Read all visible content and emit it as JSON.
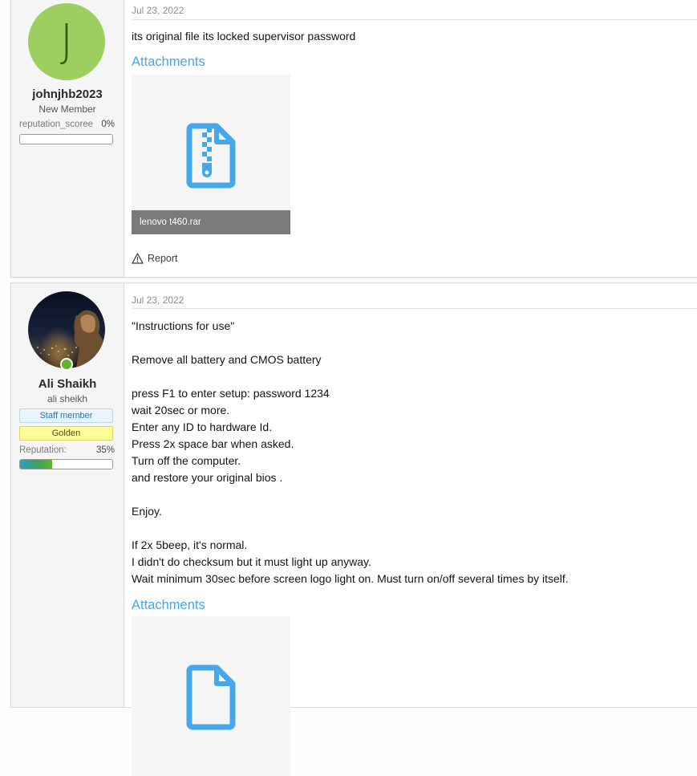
{
  "posts": [
    {
      "author": {
        "initial": "J",
        "name": "johnjhb2023",
        "title": "New Member",
        "rep_label": "reputation_scoree",
        "rep_pct": "0%",
        "rep_value": 0
      },
      "date": "Jul 23, 2022",
      "body": "its original file its locked supervisor password",
      "attachments_label": "Attachments",
      "attachment": {
        "filename": "lenovo t460.rar",
        "icon": "zip-file-icon"
      },
      "report_label": "Report"
    },
    {
      "author": {
        "name": "Ali Shaikh",
        "title": "ali sheikh",
        "badge_staff": "Staff member",
        "badge_rank": "Golden",
        "rep_label": "Reputation:",
        "rep_pct": "35%",
        "rep_value": 35,
        "online": true
      },
      "date": "Jul 23, 2022",
      "body_lines": [
        "\"Instructions for use\"",
        "",
        "Remove all battery and CMOS battery",
        "",
        "press F1 to enter setup: password 1234",
        "wait 20sec or more.",
        "Enter any ID to hardware Id.",
        "Press 2x space bar when asked.",
        "Turn off the computer.",
        "and restore your original bios .",
        "",
        "Enjoy.",
        "",
        "If 2x 5beep, it's normal.",
        "I didn't do checksum but it must light up anyway.",
        "Wait minimum 30sec before screen logo light on. Must turn on/off several times by itself."
      ],
      "attachments_label": "Attachments",
      "attachment": {
        "icon": "file-icon"
      }
    }
  ],
  "colors": {
    "link": "#47a7eb",
    "avatar_bg": "#9ccf5f",
    "online": "#64b131",
    "staff_badge": "#eaf4fc",
    "golden_badge": "#ffff99"
  }
}
